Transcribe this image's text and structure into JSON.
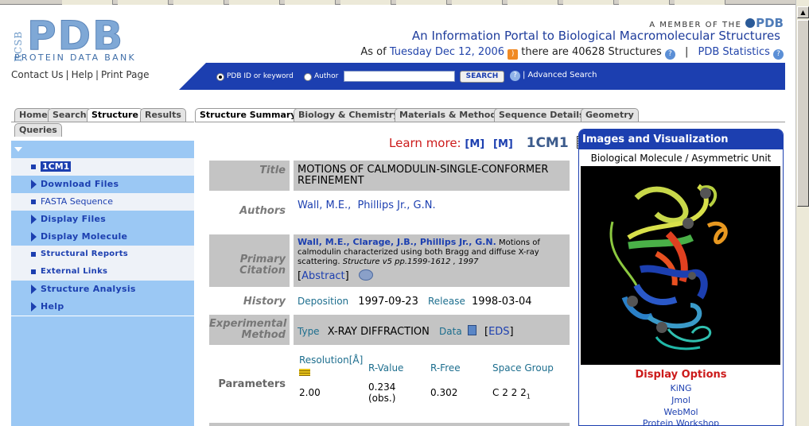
{
  "header": {
    "logo_side": "RCSB",
    "logo_main": "PDB",
    "logo_sub": "PROTEIN DATA BANK",
    "member_text": "A MEMBER OF THE",
    "member_pdb": "PDB",
    "portal_title": "An Information Portal to Biological Macromolecular Structures",
    "asof_prefix": "As of",
    "asof_date": "Tuesday Dec 12, 2006",
    "asof_middle": "there are 40628 Structures",
    "sep": "|",
    "pdb_statistics": "PDB Statistics",
    "contact_links": [
      "Contact Us",
      "Help",
      "Print Page"
    ]
  },
  "search": {
    "opt_id": "PDB ID or keyword",
    "opt_author": "Author",
    "button": "SEARCH",
    "help": "?",
    "advanced": "| Advanced Search"
  },
  "left_tabs": [
    "Home",
    "Search",
    "Structure",
    "Results",
    "Queries"
  ],
  "left_nav": [
    {
      "label": "1CM1",
      "kind": "square",
      "selected": true
    },
    {
      "label": "Download Files",
      "kind": "arrow"
    },
    {
      "label": "FASTA Sequence",
      "kind": "square"
    },
    {
      "label": "Display Files",
      "kind": "arrow"
    },
    {
      "label": "Display Molecule",
      "kind": "arrow"
    },
    {
      "label": "Structural Reports",
      "kind": "square"
    },
    {
      "label": "External Links",
      "kind": "square"
    },
    {
      "label": "Structure Analysis",
      "kind": "arrow"
    },
    {
      "label": "Help",
      "kind": "arrow"
    }
  ],
  "main_tabs": [
    "Structure Summary",
    "Biology & Chemistry",
    "Materials & Methods",
    "Sequence Details",
    "Geometry"
  ],
  "learn": {
    "text": "Learn more:",
    "m1": "[M]",
    "m2": "[M]",
    "pdb_id": "1CM1"
  },
  "summary": {
    "title_label": "Title",
    "title_value": "MOTIONS OF CALMODULIN-SINGLE-CONFORMER REFINEMENT",
    "authors_label": "Authors",
    "authors": [
      "Wall, M.E.,",
      "Phillips Jr., G.N."
    ],
    "citation_label": "Primary Citation",
    "citation_authors": "Wall, M.E., Clarage, J.B., Phillips Jr., G.N.",
    "citation_title": "Motions of calmodulin characterized using both Bragg and diffuse X-ray scattering.",
    "citation_journal": "Structure v5 pp.1599-1612 , 1997",
    "abstract": "Abstract",
    "history_label": "History",
    "deposition_label": "Deposition",
    "deposition_date": "1997-09-23",
    "release_label": "Release",
    "release_date": "1998-03-04",
    "exp_label": "Experimental Method",
    "type_label": "Type",
    "type_value": "X-RAY DIFFRACTION",
    "data_label": "Data",
    "eds": "EDS",
    "params_label": "Parameters",
    "params_headers": [
      "Resolution[Å]",
      "R-Value",
      "R-Free",
      "Space Group"
    ],
    "params_values": [
      "2.00",
      "0.234 (obs.)",
      "0.302",
      "C 2 2 2"
    ],
    "space_group_sub": "1"
  },
  "right_panel": {
    "title": "Images and Visualization",
    "subtitle": "Biological Molecule / Asymmetric Unit",
    "display_options": "Display Options",
    "options": [
      "KiNG",
      "Jmol",
      "WebMol",
      "Protein Workshop"
    ]
  }
}
